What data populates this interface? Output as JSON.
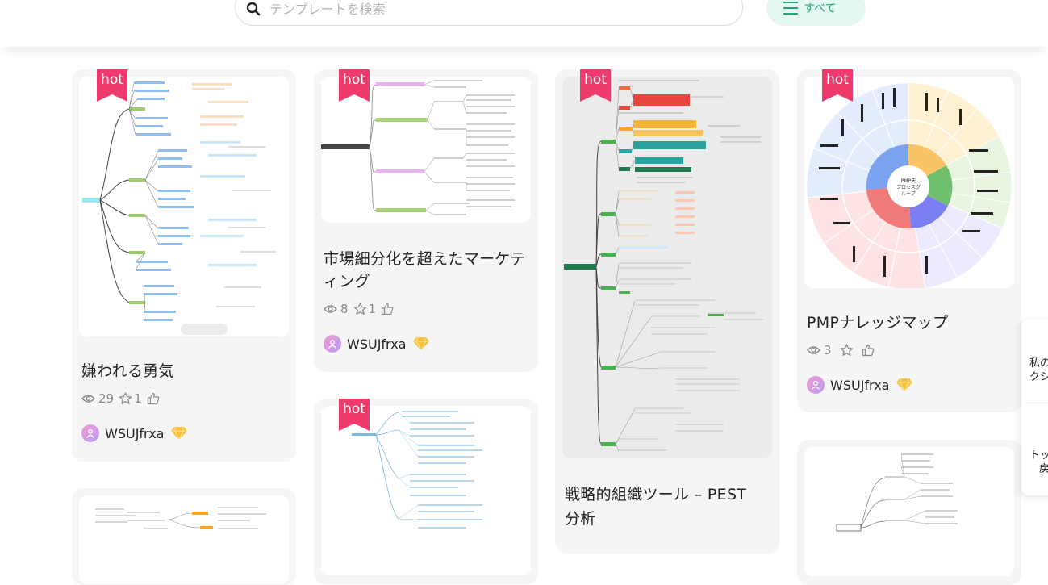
{
  "header": {
    "search": {
      "placeholder": "テンプレートを検索",
      "icon": "search-icon"
    },
    "filter": {
      "label": "すべて",
      "icon": "menu-lines-icon",
      "color": "#22a67e",
      "bg": "#e5f7f1"
    }
  },
  "badge": {
    "label": "hot",
    "color": "#ef3b6c"
  },
  "cards": [
    {
      "title": "嫌われる勇気",
      "views": "29",
      "stars": "1",
      "likes": "",
      "author": "WSUJfrxa"
    },
    {
      "title_lines": [
        "市場細分化を超えたマーケテ",
        "ィング"
      ],
      "views": "8",
      "stars": "1",
      "likes": "",
      "author": "WSUJfrxa"
    },
    {
      "title_lines": [
        "戦略的組織ツール – PEST",
        "分析"
      ]
    },
    {
      "title": "PMPナレッジマップ",
      "views": "3",
      "stars": "",
      "likes": "",
      "author": "WSUJfrxa",
      "wheel_center": [
        "PMP天",
        "プロセスグ",
        "ループ"
      ]
    }
  ],
  "side_panel": {
    "item1": [
      "私の",
      "クシ"
    ],
    "item2": [
      "トッ",
      "戻"
    ]
  }
}
